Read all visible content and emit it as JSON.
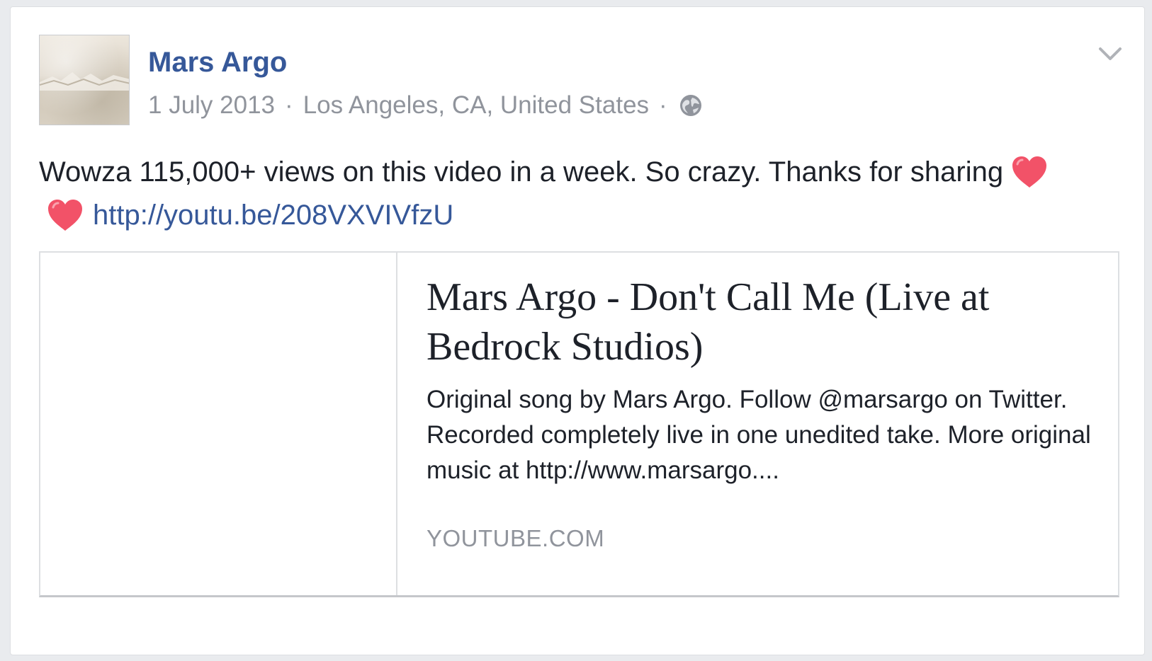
{
  "post": {
    "author": {
      "name": "Mars Argo",
      "avatar_icon": "profile-photo"
    },
    "meta": {
      "date": "1 July 2013",
      "separator": "·",
      "location": "Los Angeles, CA, United States",
      "audience_icon": "globe-icon"
    },
    "menu_icon": "chevron-down-icon",
    "text": {
      "body": "Wowza 115,000+ views on this video in a week. So crazy. Thanks for sharing",
      "emoji_icons": [
        "heart-icon",
        "heart-icon"
      ],
      "link": "http://youtu.be/208VXVIVfzU"
    },
    "link_preview": {
      "title": "Mars Argo - Don't Call Me (Live at Bedrock Studios)",
      "description": "Original song by Mars Argo. Follow @marsargo on Twitter. Recorded completely live in one unedited take. More original music at http://www.marsargo....",
      "domain": "YOUTUBE.COM"
    }
  },
  "colors": {
    "link_blue": "#365899",
    "meta_gray": "#90949c",
    "text_dark": "#1d2129",
    "heart_red": "#f25268",
    "background": "#e9ebee"
  }
}
